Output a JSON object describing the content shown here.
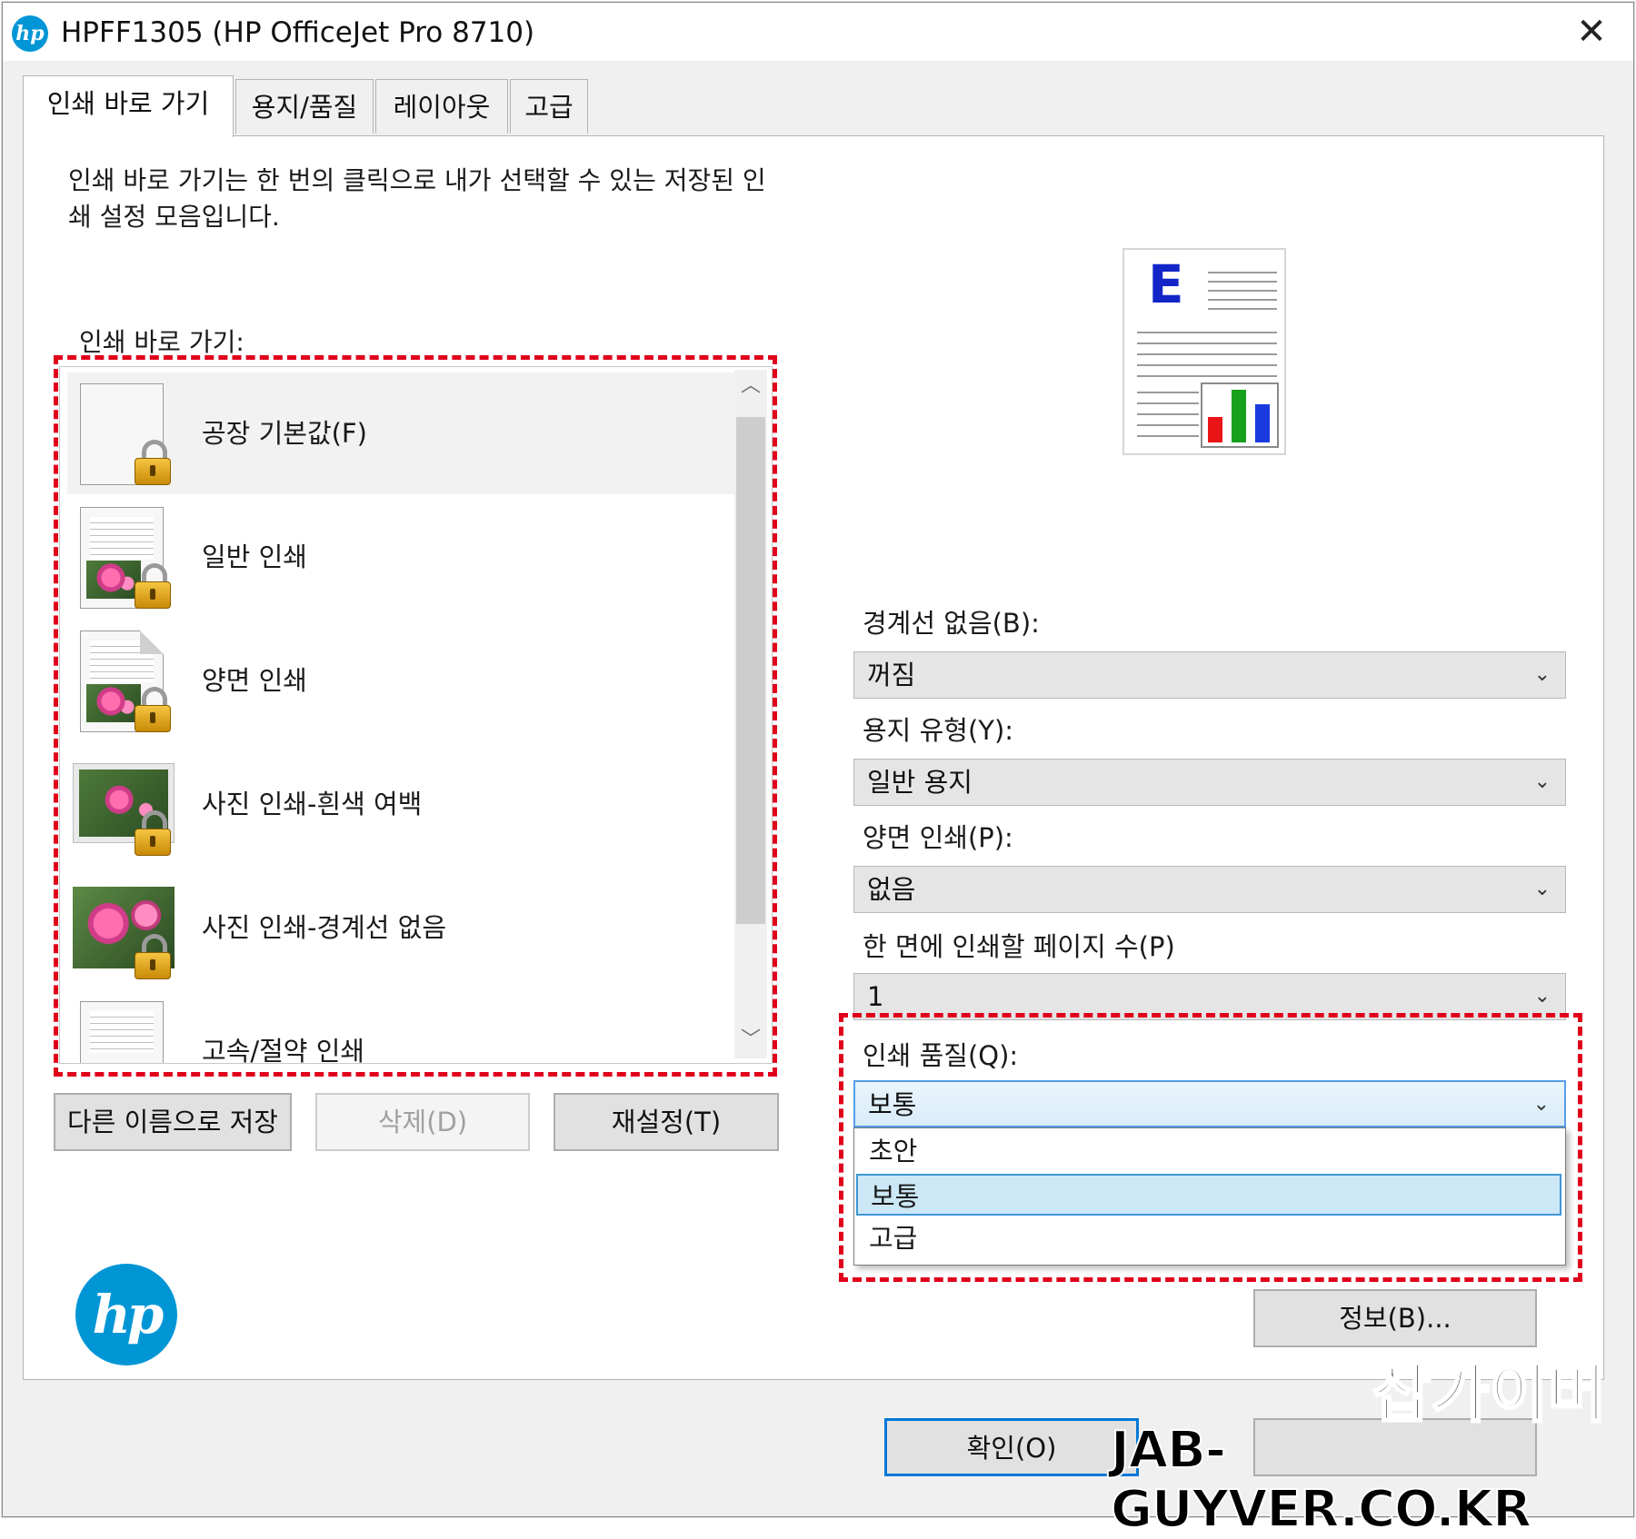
{
  "window": {
    "title": "HPFF1305 (HP OfficeJet Pro 8710)",
    "close_label": "✕"
  },
  "tabs": [
    {
      "label": "인쇄 바로 가기"
    },
    {
      "label": "용지/품질"
    },
    {
      "label": "레이아웃"
    },
    {
      "label": "고급"
    }
  ],
  "shortcuts": {
    "description": "인쇄 바로 가기는 한 번의 클릭으로 내가 선택할 수 있는 저장된 인쇄 설정 모음입니다.",
    "list_label": "인쇄 바로 가기:",
    "items": [
      {
        "label": "공장 기본값(F)"
      },
      {
        "label": "일반 인쇄"
      },
      {
        "label": "양면 인쇄"
      },
      {
        "label": "사진 인쇄-흰색 여백"
      },
      {
        "label": "사진 인쇄-경계선 없음"
      },
      {
        "label": "고속/절약 인쇄"
      }
    ],
    "buttons": {
      "save_as": "다른 이름으로 저장",
      "delete": "삭제(D)",
      "reset": "재설정(T)"
    }
  },
  "preview": {
    "letter": "E"
  },
  "settings": {
    "borderless": {
      "label": "경계선 없음(B):",
      "value": "꺼짐"
    },
    "paper_type": {
      "label": "용지 유형(Y):",
      "value": "일반 용지"
    },
    "duplex": {
      "label": "양면 인쇄(P):",
      "value": "없음"
    },
    "pages_per_sheet": {
      "label": "한 면에 인쇄할 페이지 수(P)",
      "value": "1"
    },
    "print_quality": {
      "label": "인쇄 품질(Q):",
      "value": "보통",
      "options": [
        {
          "label": "초안"
        },
        {
          "label": "보통"
        },
        {
          "label": "고급"
        }
      ]
    }
  },
  "buttons": {
    "about": "정보(B)...",
    "ok": "확인(O)"
  },
  "logo": {
    "text": "hp",
    "color": "#0096d6"
  },
  "watermark": {
    "korean": "잡가이버",
    "url": "JAB-GUYVER.CO.KR"
  },
  "colors": {
    "highlight_dashed": "#e0001b",
    "selection": "#cce8f6",
    "chart_bars": [
      "#e81416",
      "#16a01c",
      "#1a3ae0"
    ]
  }
}
